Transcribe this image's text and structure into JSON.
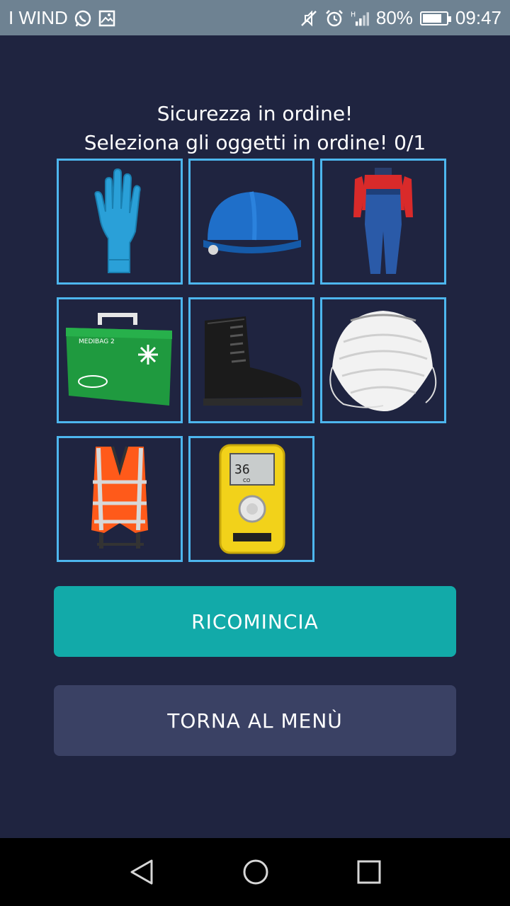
{
  "status_bar": {
    "carrier": "I WIND",
    "battery_percent": "80%",
    "battery_level": 0.8,
    "time": "09:47",
    "icons": [
      "whatsapp-icon",
      "gallery-icon",
      "mute-icon",
      "alarm-icon",
      "signal-icon",
      "battery-icon"
    ]
  },
  "quiz": {
    "title_line1": "Sicurezza in ordine!",
    "title_line2": "Seleziona gli oggetti in ordine! 0/1",
    "items": [
      {
        "name": "gloves"
      },
      {
        "name": "hard-hat"
      },
      {
        "name": "overalls"
      },
      {
        "name": "first-aid-kit",
        "text": "MEDIBAG 2"
      },
      {
        "name": "safety-boot"
      },
      {
        "name": "dust-mask"
      },
      {
        "name": "safety-harness"
      },
      {
        "name": "gas-detector",
        "reading": "36",
        "unit": "CO"
      }
    ]
  },
  "buttons": {
    "restart": "RICOMINCIA",
    "menu": "TORNA AL MENÙ"
  },
  "colors": {
    "background": "#1f2440",
    "cell_border": "#4db6ee",
    "restart_button": "#12aaa9",
    "menu_button": "#3a4164"
  },
  "nav_bar": {
    "icons": [
      "back-icon",
      "home-icon",
      "recents-icon"
    ]
  }
}
